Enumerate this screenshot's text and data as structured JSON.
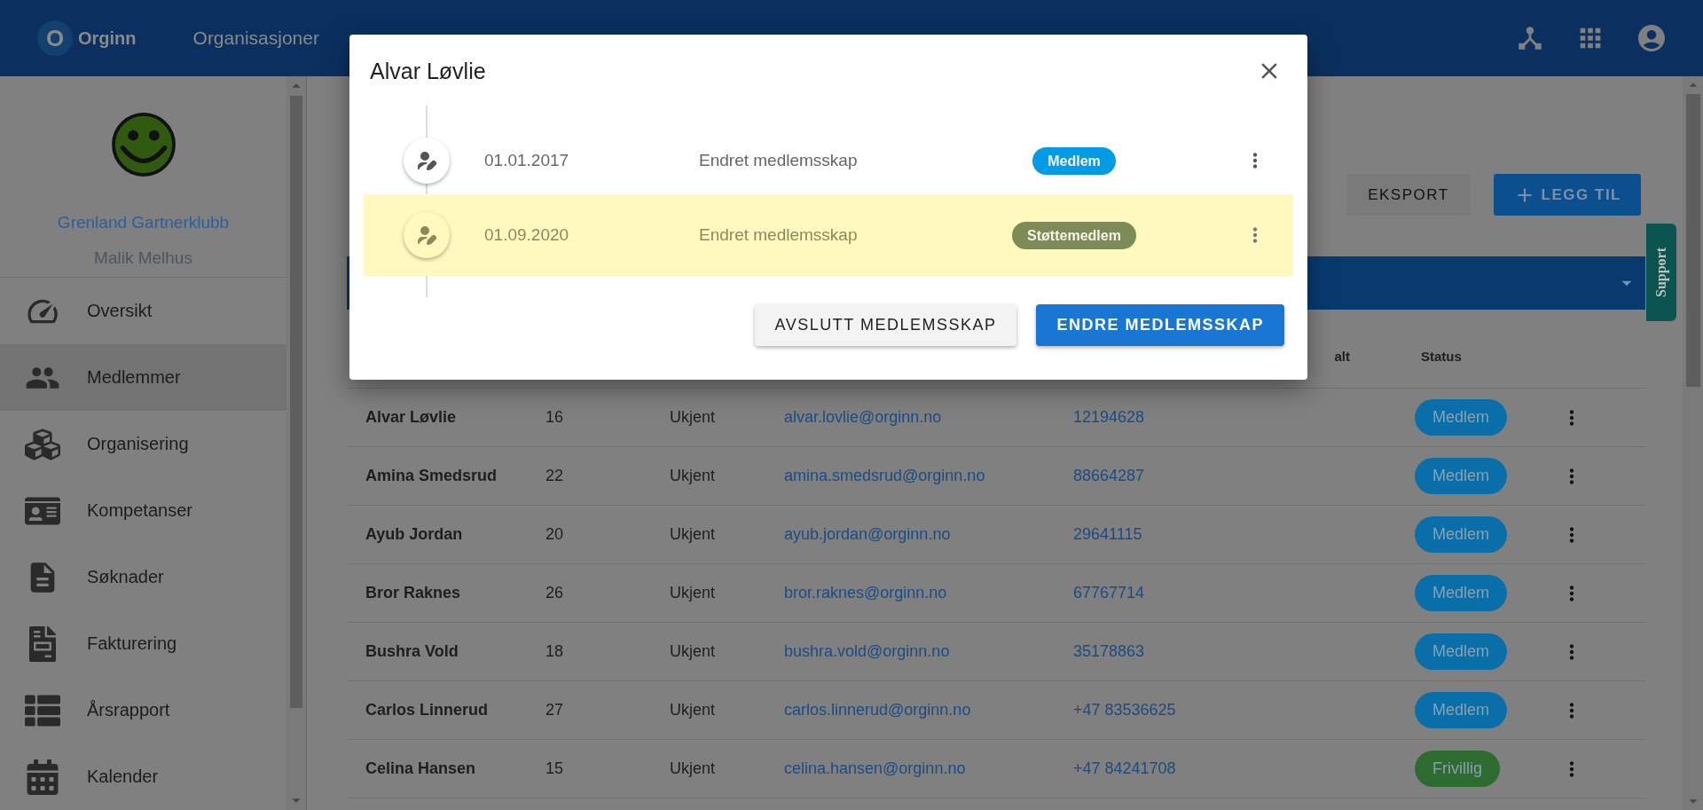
{
  "topbar": {
    "logo_letter": "O",
    "brand": "Orginn",
    "nav": [
      "Organisasjoner"
    ]
  },
  "sidebar": {
    "organization": "Grenland Gartnerklubb",
    "user": "Malik Melhus",
    "items": [
      {
        "label": "Oversikt",
        "selected": false
      },
      {
        "label": "Medlemmer",
        "selected": true
      },
      {
        "label": "Organisering",
        "selected": false
      },
      {
        "label": "Kompetanser",
        "selected": false
      },
      {
        "label": "Søknader",
        "selected": false
      },
      {
        "label": "Fakturering",
        "selected": false
      },
      {
        "label": "Årsrapport",
        "selected": false
      },
      {
        "label": "Kalender",
        "selected": false
      }
    ]
  },
  "toolbar": {
    "export": "EKSPORT",
    "add": "LEGG TIL"
  },
  "table": {
    "columns": [
      {
        "label": "alt"
      },
      {
        "label": "Status"
      }
    ],
    "rows": [
      {
        "name": "Alvar Løvlie",
        "column_2": "16",
        "column_3": "Ukjent",
        "email": "alvar.lovlie@orginn.no",
        "phone": "12194628",
        "status": "Medlem",
        "color": "#0a6fa8"
      },
      {
        "name": "Amina Smedsrud",
        "column_2": "22",
        "column_3": "Ukjent",
        "email": "amina.smedsrud@orginn.no",
        "phone": "88664287",
        "status": "Medlem",
        "color": "#0a6fa8"
      },
      {
        "name": "Ayub Jordan",
        "column_2": "20",
        "column_3": "Ukjent",
        "email": "ayub.jordan@orginn.no",
        "phone": "29641115",
        "status": "Medlem",
        "color": "#0a6fa8"
      },
      {
        "name": "Bror Raknes",
        "column_2": "26",
        "column_3": "Ukjent",
        "email": "bror.raknes@orginn.no",
        "phone": "67767714",
        "status": "Medlem",
        "color": "#0a6fa8"
      },
      {
        "name": "Bushra Vold",
        "column_2": "18",
        "column_3": "Ukjent",
        "email": "bushra.vold@orginn.no",
        "phone": "35178863",
        "status": "Medlem",
        "color": "#0a6fa8"
      },
      {
        "name": "Carlos Linnerud",
        "column_2": "27",
        "column_3": "Ukjent",
        "email": "carlos.linnerud@orginn.no",
        "phone": "+47 83536625",
        "status": "Medlem",
        "color": "#0a6fa8"
      },
      {
        "name": "Celina Hansen",
        "column_2": "15",
        "column_3": "Ukjent",
        "email": "celina.hansen@orginn.no",
        "phone": "+47 84241708",
        "status": "Frivillig",
        "color": "#2e6b30"
      }
    ]
  },
  "support": "Support",
  "dialog": {
    "title": "Alvar Løvlie",
    "entries": [
      {
        "date": "01.01.2017",
        "text": "Endret medlemsskap",
        "status": "Medlem",
        "color": "#039be5",
        "selected": false
      },
      {
        "date": "01.09.2020",
        "text": "Endret medlemsskap",
        "status": "Støttemedlem",
        "color": "#7d8b56",
        "selected": true
      }
    ],
    "buttons": {
      "end": "AVSLUTT MEDLEMSSKAP",
      "change": "ENDRE MEDLEMSSKAP"
    }
  }
}
